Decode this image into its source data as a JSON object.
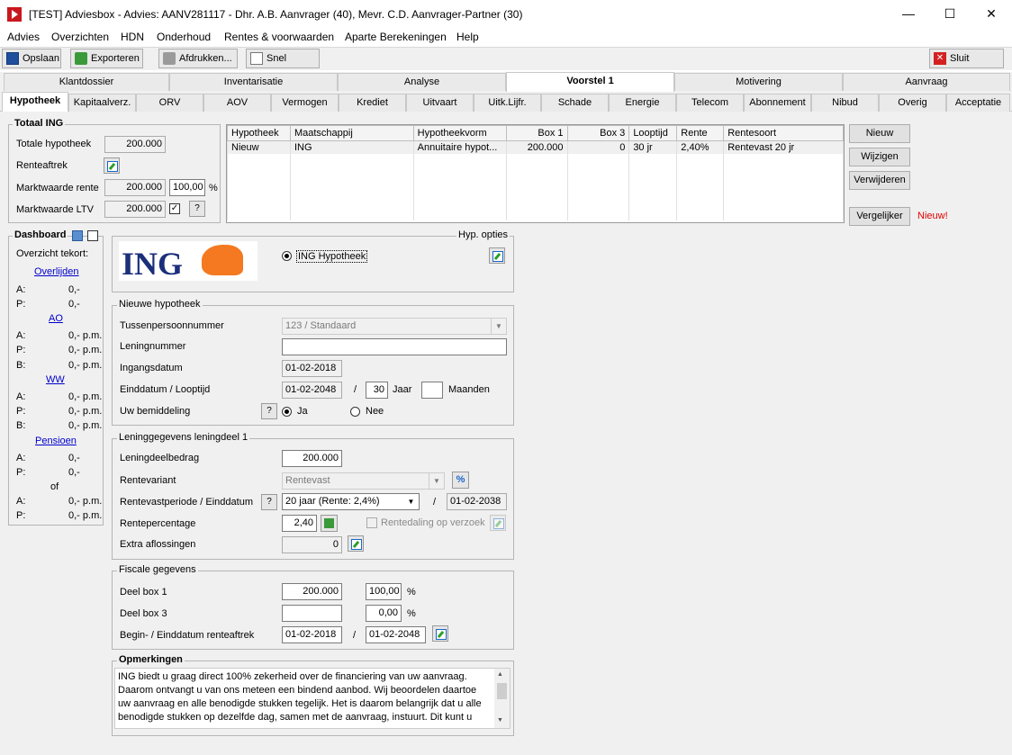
{
  "window": {
    "title": "[TEST] Adviesbox - Advies: AANV281117 - Dhr. A.B. Aanvrager (40), Mevr. C.D. Aanvrager-Partner (30)",
    "minimize": "—",
    "maximize": "☐",
    "close": "✕"
  },
  "menu": [
    "Advies",
    "Overzichten",
    "HDN",
    "Onderhoud",
    "Rentes & voorwaarden",
    "Aparte Berekeningen",
    "Help"
  ],
  "toolbar": {
    "save": "Opslaan",
    "export": "Exporteren",
    "print": "Afdrukken...",
    "quick": "Snel inzicht",
    "close": "Sluit advies"
  },
  "tabs1": [
    "Klantdossier",
    "Inventarisatie",
    "Analyse",
    "Voorstel 1",
    "Motivering",
    "Aanvraag"
  ],
  "tabs2": [
    "Hypotheek",
    "Kapitaalverz.",
    "ORV",
    "AOV",
    "Vermogen",
    "Krediet",
    "Uitvaart",
    "Uitk.Lijfr.",
    "Schade",
    "Energie",
    "Telecom",
    "Abonnement",
    "Nibud",
    "Overig",
    "Acceptatie"
  ],
  "totaal": {
    "legend": "Totaal ING",
    "totale_hypotheek_label": "Totale hypotheek",
    "totale_hypotheek": "200.000",
    "renteaftrek_label": "Renteaftrek",
    "marktwaarde_rente_label": "Marktwaarde rente",
    "marktwaarde_rente": "200.000",
    "marktwaarde_pct": "100,00",
    "pct": "%",
    "ltv_label": "Marktwaarde LTV",
    "ltv": "200.000",
    "q": "?",
    "check": "✓"
  },
  "grid": {
    "headers": [
      "Hypotheek",
      "Maatschappij",
      "Hypotheekvorm",
      "Box 1",
      "Box 3",
      "Looptijd",
      "Rente",
      "Rentesoort"
    ],
    "rows": [
      [
        "Nieuw",
        "ING",
        "Annuitaire hypot...",
        "200.000",
        "0",
        "30 jr",
        "2,40%",
        "Rentevast 20 jr"
      ]
    ]
  },
  "grid_buttons": {
    "new": "Nieuw",
    "edit": "Wijzigen",
    "delete": "Verwijderen",
    "compare": "Vergelijker",
    "new_badge": "Nieuw!"
  },
  "dashboard": {
    "title": "Dashboard",
    "overzicht": "Overzicht tekort:",
    "overlijden": "Overlijden",
    "ov_a_l": "A:",
    "ov_a": "0,-",
    "ov_p_l": "P:",
    "ov_p": "0,-",
    "ao": "AO",
    "ao_a_l": "A:",
    "ao_a": "0,- p.m.",
    "ao_p_l": "P:",
    "ao_p": "0,- p.m.",
    "ao_b_l": "B:",
    "ao_b": "0,- p.m.",
    "ww": "WW",
    "ww_a_l": "A:",
    "ww_a": "0,- p.m.",
    "ww_p_l": "P:",
    "ww_p": "0,- p.m.",
    "ww_b_l": "B:",
    "ww_b": "0,- p.m.",
    "pensioen": "Pensioen",
    "pe_a_l": "A:",
    "pe_a": "0,-",
    "pe_p_l": "P:",
    "pe_p": "0,-",
    "of": "of",
    "pe_a2_l": "A:",
    "pe_a2": "0,- p.m.",
    "pe_p2_l": "P:",
    "pe_p2": "0,- p.m."
  },
  "lender": {
    "logo": "ING",
    "hyp_opties": "Hyp. opties",
    "product": "ING Hypotheek"
  },
  "nieuwe": {
    "legend": "Nieuwe hypotheek",
    "tussen_label": "Tussenpersoonnummer",
    "tussen": "123 / Standaard",
    "lening_label": "Leningnummer",
    "lening": "",
    "ingang_label": "Ingangsdatum",
    "ingang": "01-02-2018",
    "eind_label": "Einddatum / Looptijd",
    "eind": "01-02-2048",
    "slash": "/",
    "jaar_val": "30",
    "jaar": "Jaar",
    "maanden_val": "",
    "maanden": "Maanden",
    "bemiddeling_label": "Uw bemiddeling",
    "q": "?",
    "ja": "Ja",
    "nee": "Nee"
  },
  "leningdeel": {
    "legend": "Leninggegevens leningdeel 1",
    "bedrag_label": "Leningdeelbedrag",
    "bedrag": "200.000",
    "variant_label": "Rentevariant",
    "variant": "Rentevast",
    "periode_label": "Rentevastperiode / Einddatum",
    "q": "?",
    "periode": "20 jaar (Rente: 2,4%)",
    "slash": "/",
    "periode_eind": "01-02-2038",
    "pct_label": "Rentepercentage",
    "pct": "2,40",
    "dal_label": "Rentedaling op verzoek",
    "extra_label": "Extra aflossingen",
    "extra": "0"
  },
  "fiscaal": {
    "legend": "Fiscale gegevens",
    "box1_label": "Deel box 1",
    "box1": "200.000",
    "box1_pct": "100,00",
    "pct": "%",
    "box3_label": "Deel box 3",
    "box3": "",
    "box3_pct": "0,00",
    "aftrek_label": "Begin- / Einddatum renteaftrek",
    "begin": "01-02-2018",
    "slash": "/",
    "eind": "01-02-2048"
  },
  "opmerkingen": {
    "legend": "Opmerkingen",
    "text": "ING biedt u graag direct 100% zekerheid over de financiering van uw aanvraag. Daarom ontvangt u van ons meteen een bindend aanbod. Wij beoordelen daartoe uw aanvraag en alle benodigde stukken tegelijk. Het is daarom belangrijk dat u alle benodigde stukken op dezelfde dag, samen met de aanvraag, instuurt. Dit kunt u doen"
  },
  "colors": {
    "accent": "#c8181e",
    "badge": "#e00000",
    "ing_blue": "#1b2f7a",
    "ing_orange": "#f47920"
  }
}
